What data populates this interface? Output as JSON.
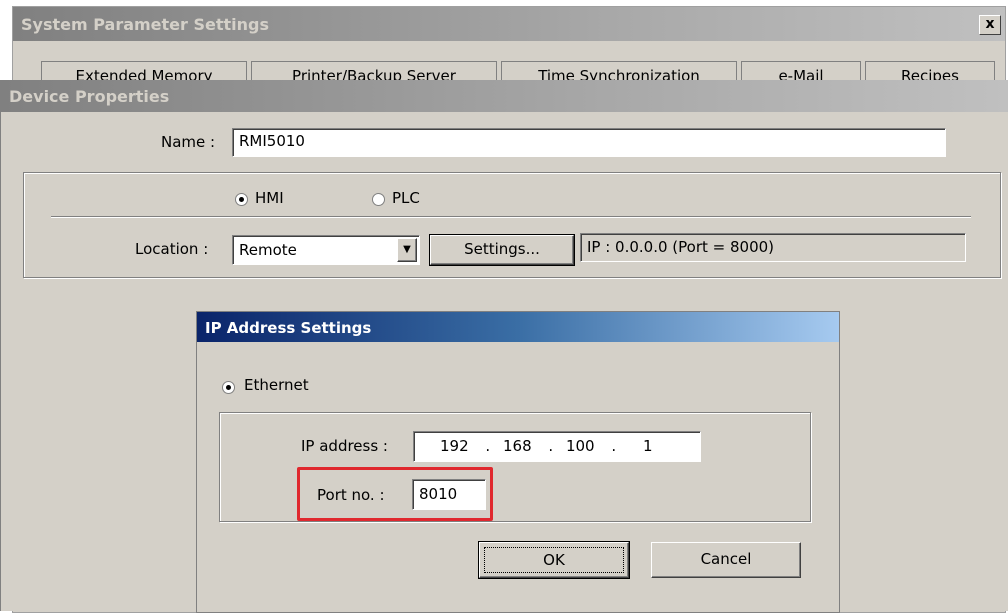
{
  "system_window": {
    "title": "System Parameter Settings",
    "close_glyph": "x",
    "tabs": [
      "Extended Memory",
      "Printer/Backup Server",
      "Time Synchronization",
      "e-Mail",
      "Recipes"
    ]
  },
  "device_window": {
    "title": "Device Properties",
    "name_label": "Name :",
    "name_value": "RMI5010",
    "radio_hmi": "HMI",
    "radio_plc": "PLC",
    "selected_type": "HMI",
    "location_label": "Location :",
    "location_value": "Remote",
    "settings_button": "Settings...",
    "ip_info": "IP : 0.0.0.0 (Port = 8000)"
  },
  "ip_dialog": {
    "title": "IP Address Settings",
    "ethernet_label": "Ethernet",
    "ip_label": "IP address :",
    "ip_octets": [
      "192",
      "168",
      "100",
      "1"
    ],
    "ip_separator": ".",
    "port_label": "Port no. :",
    "port_value": "8010",
    "ok_button": "OK",
    "cancel_button": "Cancel",
    "highlight_color": "#e0282e"
  }
}
